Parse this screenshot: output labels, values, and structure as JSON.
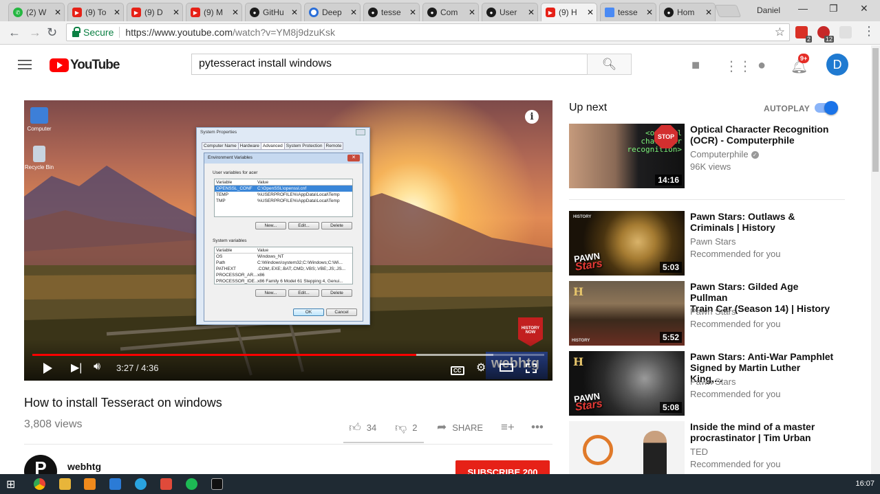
{
  "browser": {
    "tabs": [
      {
        "label": "(2) W",
        "icon": "whatsapp-icon"
      },
      {
        "label": "(9) To",
        "icon": "youtube-icon"
      },
      {
        "label": "(9) D",
        "icon": "youtube-icon"
      },
      {
        "label": "(9) M",
        "icon": "youtube-icon"
      },
      {
        "label": "GitHu",
        "icon": "github-icon"
      },
      {
        "label": "Deep",
        "icon": "deep-icon"
      },
      {
        "label": "tesse",
        "icon": "github-icon"
      },
      {
        "label": "Com",
        "icon": "github-icon"
      },
      {
        "label": "User",
        "icon": "github-icon"
      },
      {
        "label": "(9) H",
        "icon": "youtube-icon"
      },
      {
        "label": "tesse",
        "icon": "docs-icon"
      },
      {
        "label": "Hom",
        "icon": "github-icon"
      }
    ],
    "active_tab_index": 9,
    "profile_name": "Daniel",
    "secure_label": "Secure",
    "url_host": "https://www.youtube.com",
    "url_path": "/watch?v=YM8j9dzuKsk",
    "extension_badges": [
      "2",
      "12"
    ]
  },
  "masthead": {
    "logo_text": "YouTube",
    "search_value": "pytesseract install windows",
    "notification_count": "9+",
    "avatar_letter": "D"
  },
  "player": {
    "current_time": "3:27",
    "duration": "4:36",
    "time_display": "3:27 / 4:36",
    "progress_fraction": 0.75,
    "buffered_fraction": 0.9,
    "cc_label": "CC",
    "watermark_text": "webhtg",
    "badge_text": "HISTORY NOW",
    "desktop_icons": [
      "Computer",
      "Recycle Bin"
    ],
    "dialog": {
      "outer_title": "System Properties",
      "tabs": [
        "Computer Name",
        "Hardware",
        "Advanced",
        "System Protection",
        "Remote"
      ],
      "inner_title": "Environment Variables",
      "user_vars_label": "User variables for acer",
      "col_variable": "Variable",
      "col_value": "Value",
      "user_vars": [
        {
          "name": "OPENSSL_CONF",
          "value": "C:\\OpenSSL\\openssl.cnf"
        },
        {
          "name": "TEMP",
          "value": "%USERPROFILE%\\AppData\\Local\\Temp"
        },
        {
          "name": "TMP",
          "value": "%USERPROFILE%\\AppData\\Local\\Temp"
        }
      ],
      "system_vars_label": "System variables",
      "system_vars": [
        {
          "name": "OS",
          "value": "Windows_NT"
        },
        {
          "name": "Path",
          "value": "C:\\Windows\\system32;C:\\Windows;C:\\Wi..."
        },
        {
          "name": "PATHEXT",
          "value": ".COM;.EXE;.BAT;.CMD;.VBS;.VBE;.JS;.JS..."
        },
        {
          "name": "PROCESSOR_AR...",
          "value": "x86"
        },
        {
          "name": "PROCESSOR_IDE...",
          "value": "x86 Family 6 Model 61 Stepping 4, Genui..."
        }
      ],
      "btn_new": "New...",
      "btn_edit": "Edit...",
      "btn_delete": "Delete",
      "btn_ok": "OK",
      "btn_cancel": "Cancel"
    }
  },
  "video": {
    "title": "How to install Tesseract on windows",
    "views": "3,808 views",
    "likes": "34",
    "dislikes": "2",
    "share_label": "SHARE",
    "channel_name": "webhtg",
    "channel_avatar_letter": "P",
    "subscribe_label": "SUBSCRIBE",
    "subscriber_count": "200"
  },
  "sidebar": {
    "up_next_label": "Up next",
    "autoplay_label": "AUTOPLAY",
    "autoplay_on": true,
    "items": [
      {
        "title_line1": "Optical Character Recognition",
        "title_line2": "(OCR) - Computerphile",
        "channel": "Computerphile",
        "meta": "96K views",
        "duration": "14:16",
        "thumb_text": "<optical character recognition>",
        "thumb_sign": "STOP"
      },
      {
        "title_line1": "Pawn Stars: Outlaws &",
        "title_line2": "Criminals | History",
        "channel": "Pawn Stars",
        "meta": "Recommended for you",
        "duration": "5:03",
        "thumb_brand": "HISTORY"
      },
      {
        "title_line1": "Pawn Stars: Gilded Age Pullman",
        "title_line2": "Train Car (Season 14) | History",
        "channel": "Pawn Stars",
        "meta": "Recommended for you",
        "duration": "5:52",
        "thumb_brand": "HISTORY"
      },
      {
        "title_line1": "Pawn Stars: Anti-War Pamphlet",
        "title_line2": "Signed by Martin Luther King,...",
        "channel": "Pawn Stars",
        "meta": "Recommended for you",
        "duration": "5:08"
      },
      {
        "title_line1": "Inside the mind of a master",
        "title_line2": "procrastinator | Tim Urban",
        "channel": "TED",
        "meta": "Recommended for you"
      }
    ]
  },
  "taskbar": {
    "clock": "16:07"
  }
}
